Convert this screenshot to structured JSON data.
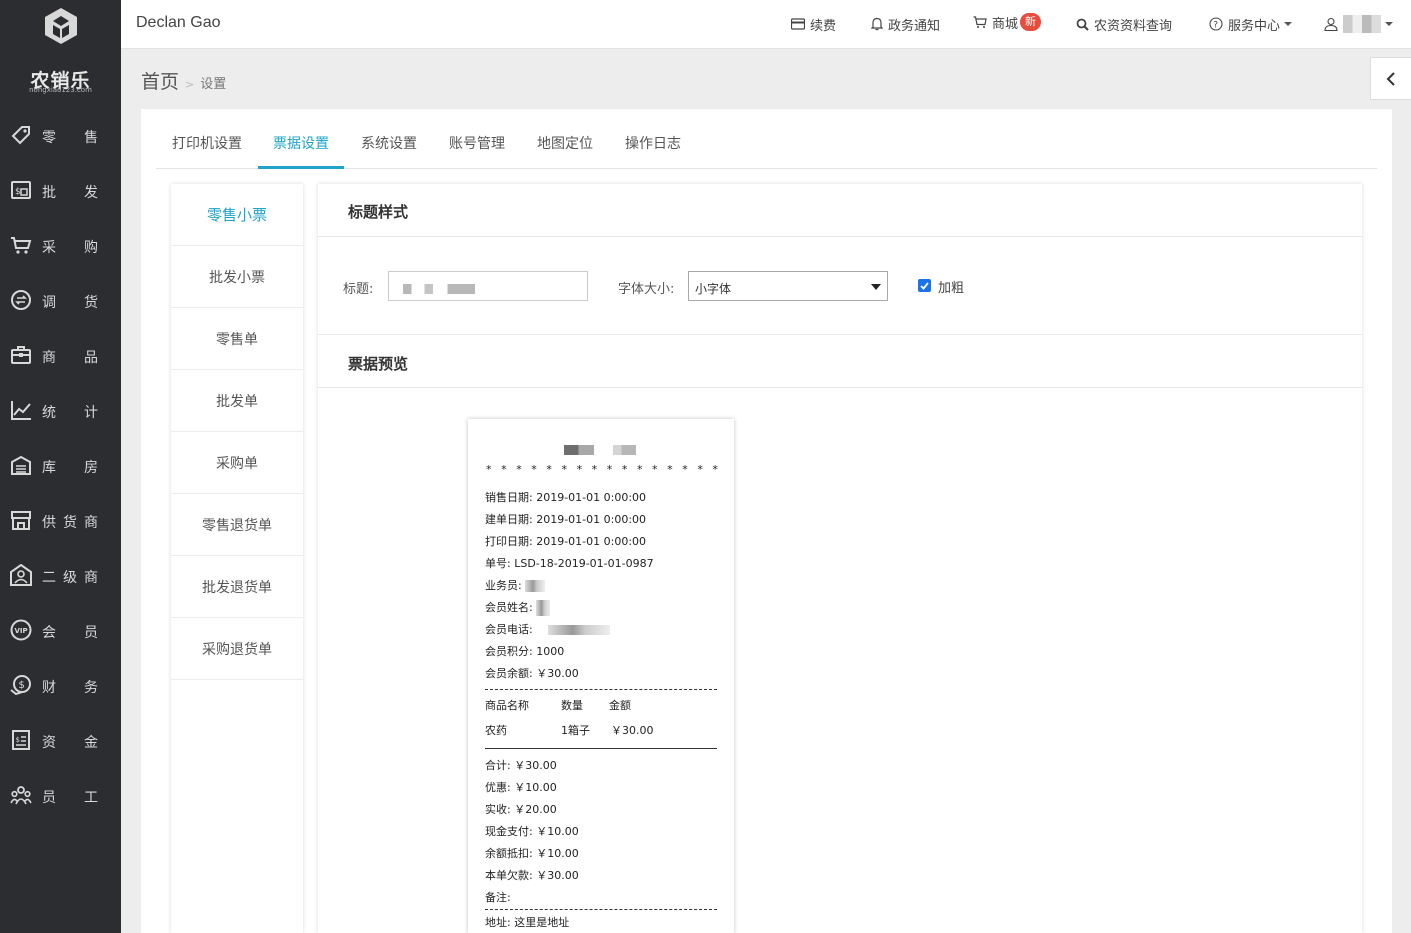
{
  "brand": {
    "name": "农销乐",
    "sub": "nongxiao123.com"
  },
  "sidebar": {
    "items": [
      {
        "label": "零售",
        "icon": "tag-icon"
      },
      {
        "label": "批发",
        "icon": "wholesale-icon"
      },
      {
        "label": "采购",
        "icon": "cart-icon"
      },
      {
        "label": "调货",
        "icon": "transfer-icon"
      },
      {
        "label": "商品",
        "icon": "briefcase-icon"
      },
      {
        "label": "统计",
        "icon": "chart-icon"
      },
      {
        "label": "库房",
        "icon": "warehouse-icon"
      },
      {
        "label": "供货商",
        "icon": "store-icon"
      },
      {
        "label": "二级商",
        "icon": "person-icon"
      },
      {
        "label": "会员",
        "icon": "vip-icon"
      },
      {
        "label": "财务",
        "icon": "money-icon"
      },
      {
        "label": "资金",
        "icon": "funds-icon"
      },
      {
        "label": "员工",
        "icon": "team-icon"
      }
    ]
  },
  "topbar": {
    "user_title": "Declan Gao",
    "renew": "续费",
    "notice": "政务通知",
    "mall": "商城",
    "mall_badge": "新",
    "query": "农资资料查询",
    "service": "服务中心"
  },
  "breadcrumb": {
    "home": "首页",
    "sep": ">",
    "current": "设置"
  },
  "tabs": [
    "打印机设置",
    "票据设置",
    "系统设置",
    "账号管理",
    "地图定位",
    "操作日志"
  ],
  "active_tab": "票据设置",
  "subnav": [
    "零售小票",
    "批发小票",
    "零售单",
    "批发单",
    "采购单",
    "零售退货单",
    "批发退货单",
    "采购退货单"
  ],
  "active_subnav": "零售小票",
  "title_style": {
    "heading": "标题样式",
    "title_label": "标题:",
    "font_label": "字体大小:",
    "font_value": "小字体",
    "bold_label": "加粗",
    "bold_checked": true
  },
  "preview": {
    "heading": "票据预览",
    "stars": "* * * * * * * * * * * * * * * *",
    "sale_date": "销售日期: 2019-01-01 0:00:00",
    "create_date": "建单日期: 2019-01-01 0:00:00",
    "print_date": "打印日期: 2019-01-01 0:00:00",
    "order_no": "单号: LSD-18-2019-01-01-0987",
    "salesman": "业务员:",
    "member_name": "会员姓名:",
    "member_phone": "会员电话:",
    "member_points": "会员积分: 1000",
    "member_balance": "会员余额: ￥30.00",
    "col_name": "商品名称",
    "col_qty": "数量",
    "col_amount": "金额",
    "item_name": "农药",
    "item_qty": "1箱子",
    "item_amount": "￥30.00",
    "total": "合计: ￥30.00",
    "discount": "优惠: ￥10.00",
    "received": "实收: ￥20.00",
    "cash": "现金支付: ￥10.00",
    "balance_deduct": "余额抵扣: ￥10.00",
    "debt": "本单欠款: ￥30.00",
    "remark": "备注:",
    "address": "地址: 这里是地址"
  },
  "colors": {
    "sidebar": "#2b2d30",
    "accent": "#1fa3c9",
    "badge": "#e74c3c",
    "checkbox": "#1a73e8"
  }
}
